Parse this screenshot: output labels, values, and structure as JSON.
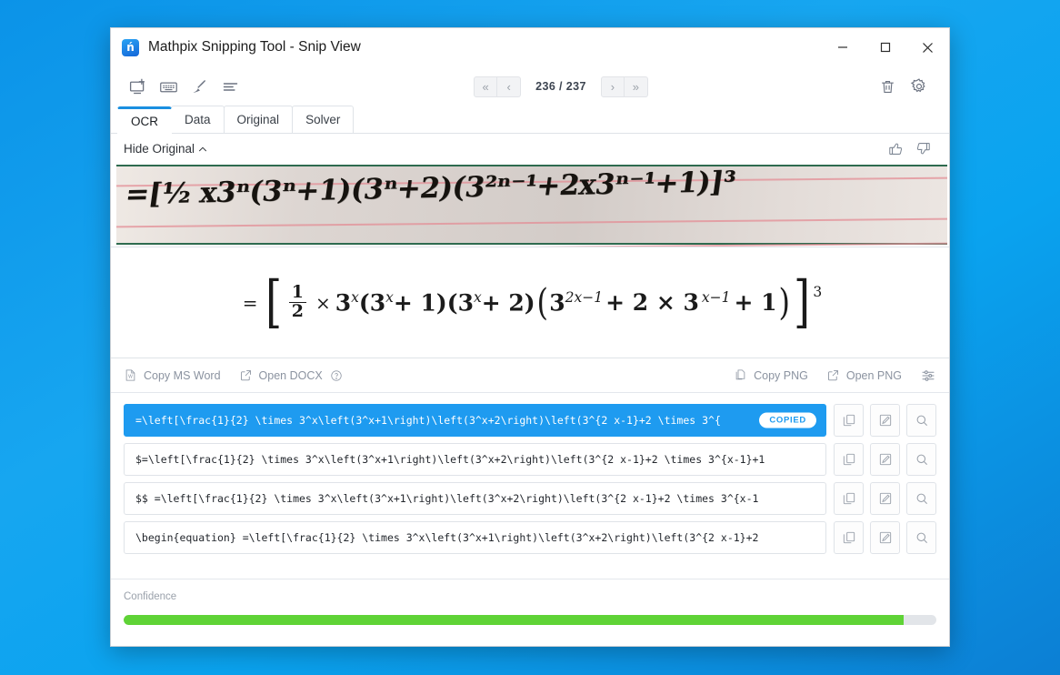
{
  "window": {
    "title": "Mathpix Snipping Tool - Snip View",
    "app_icon": "mathpix-logo-icon",
    "controls": {
      "minimize": "—",
      "maximize": "□",
      "close": "✕"
    }
  },
  "toolbar": {
    "left_icons": [
      {
        "name": "new-snip-icon",
        "glyph": "screen-capture"
      },
      {
        "name": "keyboard-icon",
        "glyph": "keyboard"
      },
      {
        "name": "draw-icon",
        "glyph": "pen"
      },
      {
        "name": "list-icon",
        "glyph": "lines"
      }
    ],
    "pager": {
      "first_label": "«",
      "prev_label": "‹",
      "page_label": "236 / 237",
      "current_page": 236,
      "total_pages": 237,
      "next_label": "›",
      "last_label": "»"
    },
    "right_icons": [
      {
        "name": "trash-icon",
        "glyph": "trash"
      },
      {
        "name": "gear-icon",
        "glyph": "gear"
      }
    ]
  },
  "tabs": [
    {
      "label": "OCR",
      "active": true
    },
    {
      "label": "Data",
      "active": false
    },
    {
      "label": "Original",
      "active": false
    },
    {
      "label": "Solver",
      "active": false
    }
  ],
  "hide_row": {
    "toggle_label": "Hide Original",
    "chevron": "chevron-up-icon",
    "thumbs_up": "thumbs-up-icon",
    "thumbs_down": "thumbs-down-icon"
  },
  "snip": {
    "alt": "handwritten-math-on-lined-paper",
    "handwriting": "=[½ x3ⁿ(3ⁿ+1)(3ⁿ+2)(3²ⁿ⁻¹+2x3ⁿ⁻¹+1)]³",
    "paper_color": "#ddd6d2",
    "rule_color": "#e38e96",
    "border_color": "#2e6b4f"
  },
  "rendered_math": {
    "equals": "=",
    "fraction_numerator": "1",
    "fraction_denominator": "2",
    "times": "×",
    "term1_base": "3",
    "term1_exp": "x",
    "group1": "(3",
    "group1_exp": "x",
    "group1_tail": "+ 1)",
    "group2": "(3",
    "group2_exp": "x",
    "group2_tail": "+ 2)",
    "group3_base": "3",
    "group3_exp": "2x−1",
    "group3_mid": "+ 2 × 3",
    "group3_exp2": "x−1",
    "group3_tail": "+ 1",
    "outer_exponent": "3"
  },
  "export_row": {
    "left": [
      {
        "icon": "word-doc-icon",
        "label": "Copy MS Word"
      },
      {
        "icon": "external-link-icon",
        "label": "Open DOCX"
      },
      {
        "icon": "help-circle-icon",
        "label": ""
      }
    ],
    "right": [
      {
        "icon": "copy-page-icon",
        "label": "Copy PNG"
      },
      {
        "icon": "external-link-icon",
        "label": "Open PNG"
      },
      {
        "icon": "sliders-icon",
        "label": ""
      }
    ]
  },
  "results": {
    "copied_badge": "COPIED",
    "action_icons": [
      {
        "name": "copy-icon"
      },
      {
        "name": "edit-icon"
      },
      {
        "name": "zoom-icon"
      }
    ],
    "rows": [
      {
        "text": "=\\left[\\frac{1}{2} \\times 3^x\\left(3^x+1\\right)\\left(3^x+2\\right)\\left(3^{2 x-1}+2 \\times 3^{",
        "selected": true,
        "copied": true
      },
      {
        "text": "$=\\left[\\frac{1}{2} \\times 3^x\\left(3^x+1\\right)\\left(3^x+2\\right)\\left(3^{2 x-1}+2 \\times 3^{x-1}+1",
        "selected": false,
        "copied": false
      },
      {
        "text": "$$  =\\left[\\frac{1}{2} \\times 3^x\\left(3^x+1\\right)\\left(3^x+2\\right)\\left(3^{2 x-1}+2 \\times 3^{x-1",
        "selected": false,
        "copied": false
      },
      {
        "text": "\\begin{equation}  =\\left[\\frac{1}{2} \\times 3^x\\left(3^x+1\\right)\\left(3^x+2\\right)\\left(3^{2 x-1}+2",
        "selected": false,
        "copied": false
      }
    ]
  },
  "confidence": {
    "label": "Confidence",
    "percent": 96,
    "fill_color": "#5fd336",
    "track_color": "#e2e5e9"
  },
  "colors": {
    "accent": "#1e9bf0",
    "tab_active_underline": "#1a8fe0",
    "desktop_background": "#0f9ae8"
  }
}
